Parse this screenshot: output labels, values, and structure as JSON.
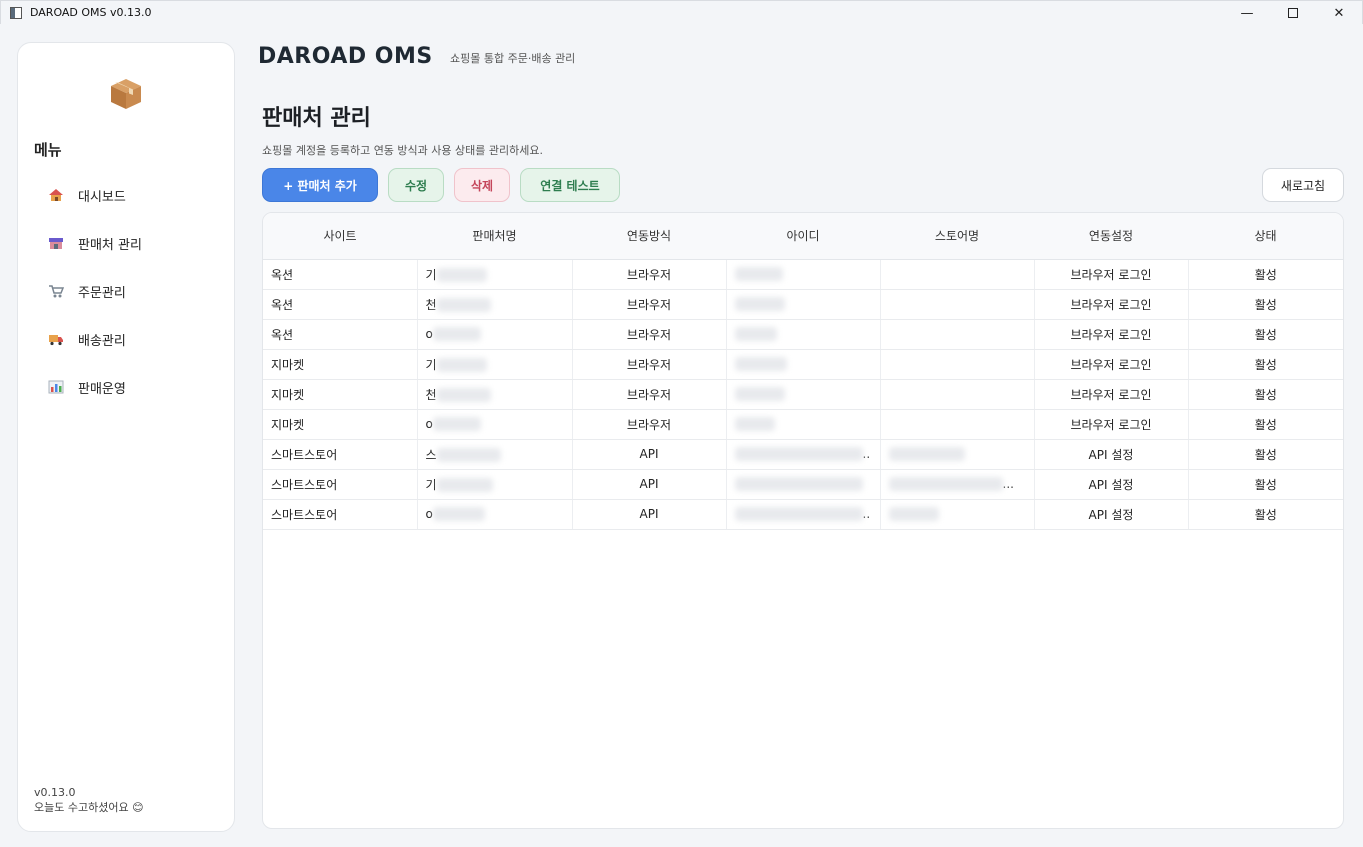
{
  "window": {
    "title": "DAROAD OMS v0.13.0"
  },
  "header": {
    "brand": "DAROAD OMS",
    "subtitle": "쇼핑몰 통합 주문·배송 관리"
  },
  "sidebar": {
    "menu_heading": "메뉴",
    "items": [
      {
        "label": "대시보드",
        "icon": "house-icon"
      },
      {
        "label": "판매처 관리",
        "icon": "store-icon"
      },
      {
        "label": "주문관리",
        "icon": "cart-icon"
      },
      {
        "label": "배송관리",
        "icon": "truck-icon"
      },
      {
        "label": "판매운영",
        "icon": "chart-icon"
      }
    ],
    "version": "v0.13.0",
    "greeting": "오늘도 수고하셨어요 😊"
  },
  "page": {
    "title": "판매처 관리",
    "description": "쇼핑몰 계정을 등록하고 연동 방식과 사용 상태를 관리하세요."
  },
  "toolbar": {
    "add_label": "+ 판매처 추가",
    "edit_label": "수정",
    "delete_label": "삭제",
    "test_label": "연결 테스트",
    "refresh_label": "새로고침"
  },
  "table": {
    "columns": [
      "사이트",
      "판매처명",
      "연동방식",
      "아이디",
      "스토어명",
      "연동설정",
      "상태"
    ],
    "rows": [
      {
        "site": "옥션",
        "seller_prefix": "기",
        "method": "브라우저",
        "setting": "브라우저 로그인",
        "status": "활성"
      },
      {
        "site": "옥션",
        "seller_prefix": "천",
        "method": "브라우저",
        "setting": "브라우저 로그인",
        "status": "활성"
      },
      {
        "site": "옥션",
        "seller_prefix": "o",
        "method": "브라우저",
        "setting": "브라우저 로그인",
        "status": "활성"
      },
      {
        "site": "지마켓",
        "seller_prefix": "기",
        "method": "브라우저",
        "setting": "브라우저 로그인",
        "status": "활성"
      },
      {
        "site": "지마켓",
        "seller_prefix": "천",
        "method": "브라우저",
        "setting": "브라우저 로그인",
        "status": "활성"
      },
      {
        "site": "지마켓",
        "seller_prefix": "o",
        "method": "브라우저",
        "setting": "브라우저 로그인",
        "status": "활성"
      },
      {
        "site": "스마트스토어",
        "seller_prefix": "스",
        "method": "API",
        "id_suffix": "..",
        "setting": "API 설정",
        "status": "활성"
      },
      {
        "site": "스마트스토어",
        "seller_prefix": "기",
        "method": "API",
        "store_suffix": "...",
        "setting": "API 설정",
        "status": "활성"
      },
      {
        "site": "스마트스토어",
        "seller_prefix": "o",
        "method": "API",
        "id_suffix": "..",
        "setting": "API 설정",
        "status": "활성"
      }
    ]
  }
}
